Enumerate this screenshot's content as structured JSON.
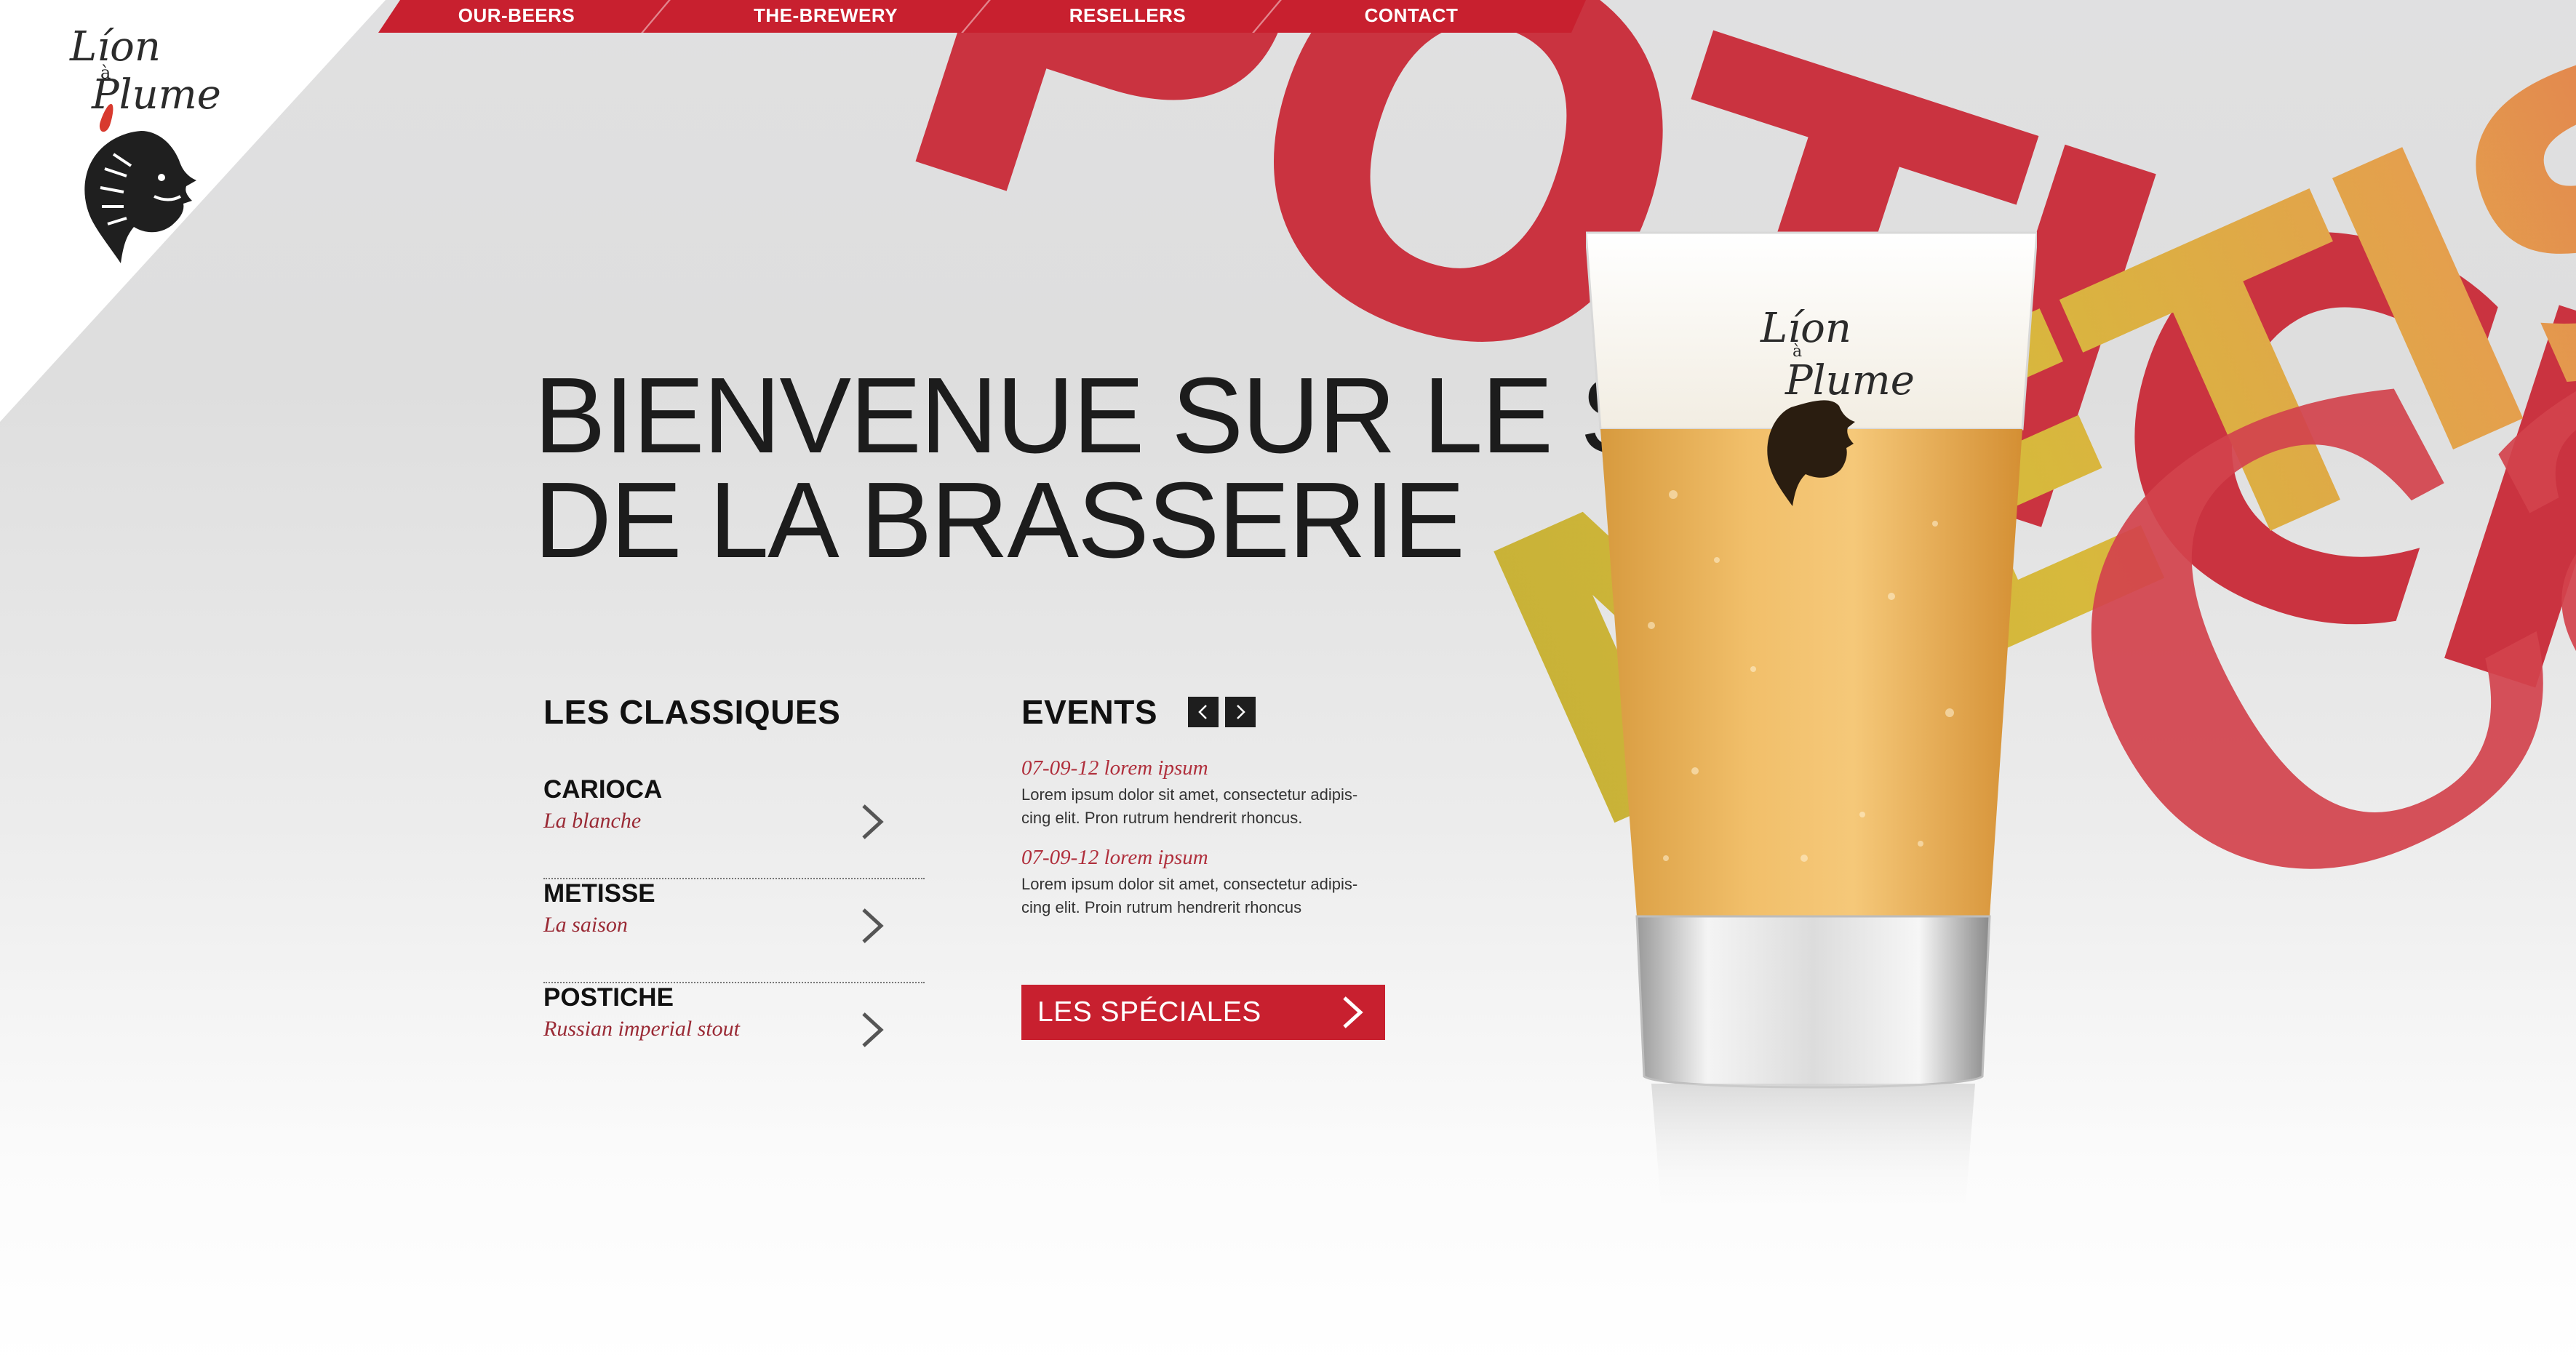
{
  "nav": {
    "items": [
      {
        "label": "OUR-BEERS"
      },
      {
        "label": "THE-BREWERY"
      },
      {
        "label": "RESELLERS"
      },
      {
        "label": "CONTACT"
      }
    ]
  },
  "logo": {
    "line1": "Líon",
    "a": "à",
    "line2": "Plume"
  },
  "welcome": {
    "line1": "BIENVENUE SUR LE SITE",
    "line2": "DE LA BRASSERIE"
  },
  "classiques": {
    "title": "LES CLASSIQUES",
    "items": [
      {
        "name": "CARIOCA",
        "subtitle": "La blanche"
      },
      {
        "name": "METISSE",
        "subtitle": "La saison"
      },
      {
        "name": "POSTICHE",
        "subtitle": "Russian imperial stout"
      }
    ]
  },
  "events": {
    "title": "EVENTS",
    "items": [
      {
        "date": "07-09-12 lorem ipsum",
        "text_line1": "Lorem ipsum dolor sit amet, consectetur adipis-",
        "text_line2": "cing elit. Pron rutrum hendrerit rhoncus."
      },
      {
        "date": "07-09-12 lorem ipsum",
        "text_line1": "Lorem ipsum dolor sit amet, consectetur adipis-",
        "text_line2": "cing elit. Proin rutrum hendrerit rhoncus"
      }
    ]
  },
  "specials": {
    "label": "LES SPÉCIALES"
  },
  "colors": {
    "brand_red": "#c8202f",
    "accent_italic": "#9a2a35",
    "text_dark": "#111111"
  }
}
